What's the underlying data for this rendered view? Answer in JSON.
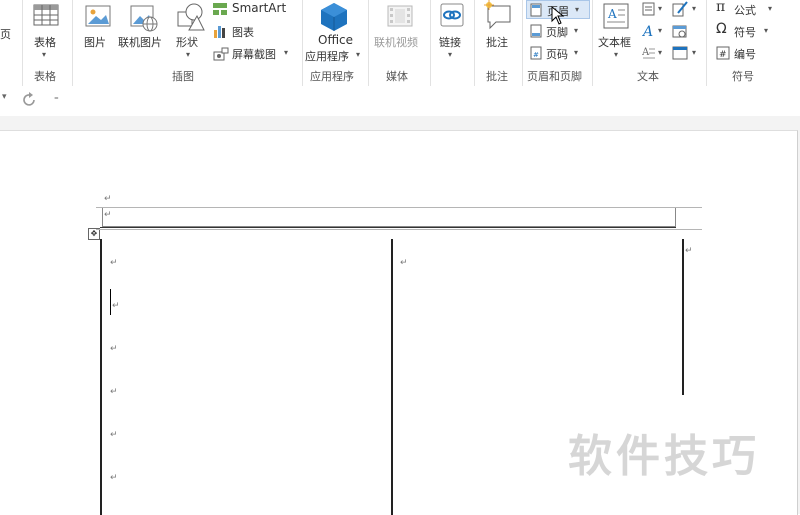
{
  "ribbon": {
    "cut_left_label": "页",
    "table": {
      "label": "表格",
      "group": "表格"
    },
    "illustrations": {
      "group": "插图",
      "picture": "图片",
      "online_picture": "联机图片",
      "shapes": "形状",
      "smartart": "SmartArt",
      "chart": "图表",
      "screenshot": "屏幕截图"
    },
    "apps": {
      "line1": "Office",
      "line2": "应用程序",
      "group": "应用程序"
    },
    "media": {
      "online_video": "联机视频",
      "group": "媒体"
    },
    "links": {
      "label": "链接"
    },
    "comments": {
      "label": "批注",
      "group": "批注"
    },
    "header_footer": {
      "header": "页眉",
      "footer": "页脚",
      "page_number": "页码",
      "group": "页眉和页脚"
    },
    "text": {
      "textbox": "文本框",
      "group": "文本"
    },
    "symbols": {
      "equation": "公式",
      "symbol": "符号",
      "number": "编号",
      "group": "符号"
    }
  },
  "qat": {
    "redo_icon": "redo-icon",
    "customize_icon": "customize-icon"
  },
  "document": {
    "paragraph_mark": "↵"
  },
  "watermark": "软件技巧",
  "colors": {
    "office_blue": "#1e73be",
    "accent_orange": "#e8a33c",
    "ribbon_border": "#d6d6d6"
  }
}
